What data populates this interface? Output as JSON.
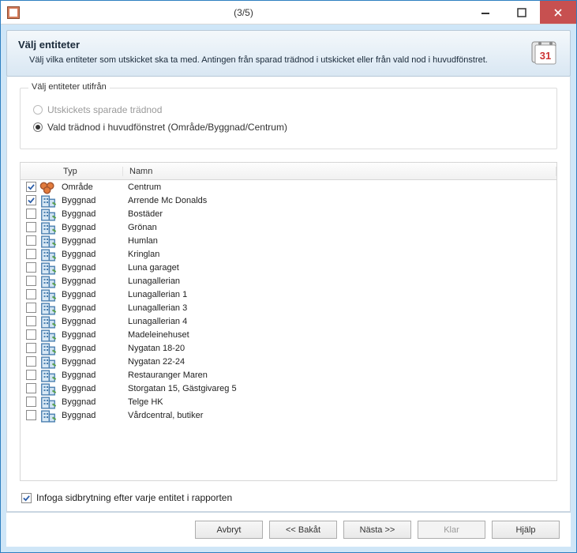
{
  "window_title": "(3/5)",
  "banner": {
    "title": "Välj entiteter",
    "subtitle": "Välj vilka entiteter som utskicket ska ta med. Antingen från sparad trädnod i utskicket eller från vald nod i huvudfönstret.",
    "calendar_day": "31"
  },
  "group": {
    "legend": "Välj entiteter utifrån",
    "opt_saved": "Utskickets sparade trädnod",
    "opt_selected": "Vald trädnod i huvudfönstret (Område/Byggnad/Centrum)"
  },
  "columns": {
    "typ": "Typ",
    "namn": "Namn"
  },
  "rows": [
    {
      "checked": true,
      "kind": "area",
      "typ": "Område",
      "namn": "Centrum"
    },
    {
      "checked": true,
      "kind": "building",
      "typ": "Byggnad",
      "namn": "Arrende Mc Donalds"
    },
    {
      "checked": false,
      "kind": "building",
      "typ": "Byggnad",
      "namn": "Bostäder"
    },
    {
      "checked": false,
      "kind": "building",
      "typ": "Byggnad",
      "namn": "Grönan"
    },
    {
      "checked": false,
      "kind": "building",
      "typ": "Byggnad",
      "namn": "Humlan"
    },
    {
      "checked": false,
      "kind": "building",
      "typ": "Byggnad",
      "namn": "Kringlan"
    },
    {
      "checked": false,
      "kind": "building",
      "typ": "Byggnad",
      "namn": "Luna garaget"
    },
    {
      "checked": false,
      "kind": "building",
      "typ": "Byggnad",
      "namn": "Lunagallerian"
    },
    {
      "checked": false,
      "kind": "building",
      "typ": "Byggnad",
      "namn": "Lunagallerian 1"
    },
    {
      "checked": false,
      "kind": "building",
      "typ": "Byggnad",
      "namn": "Lunagallerian 3"
    },
    {
      "checked": false,
      "kind": "building",
      "typ": "Byggnad",
      "namn": "Lunagallerian 4"
    },
    {
      "checked": false,
      "kind": "building",
      "typ": "Byggnad",
      "namn": "Madeleinehuset"
    },
    {
      "checked": false,
      "kind": "building",
      "typ": "Byggnad",
      "namn": "Nygatan 18-20"
    },
    {
      "checked": false,
      "kind": "building",
      "typ": "Byggnad",
      "namn": "Nygatan 22-24"
    },
    {
      "checked": false,
      "kind": "building",
      "typ": "Byggnad",
      "namn": "Restauranger Maren"
    },
    {
      "checked": false,
      "kind": "building",
      "typ": "Byggnad",
      "namn": "Storgatan 15, Gästgivareg 5"
    },
    {
      "checked": false,
      "kind": "building",
      "typ": "Byggnad",
      "namn": "Telge HK"
    },
    {
      "checked": false,
      "kind": "building",
      "typ": "Byggnad",
      "namn": "Vårdcentral, butiker"
    }
  ],
  "pagebreak_label": "Infoga sidbrytning efter varje entitet i rapporten",
  "pagebreak_checked": true,
  "buttons": {
    "cancel": "Avbryt",
    "back": "<< Bakåt",
    "next": "Nästa >>",
    "finish": "Klar",
    "help": "Hjälp"
  }
}
